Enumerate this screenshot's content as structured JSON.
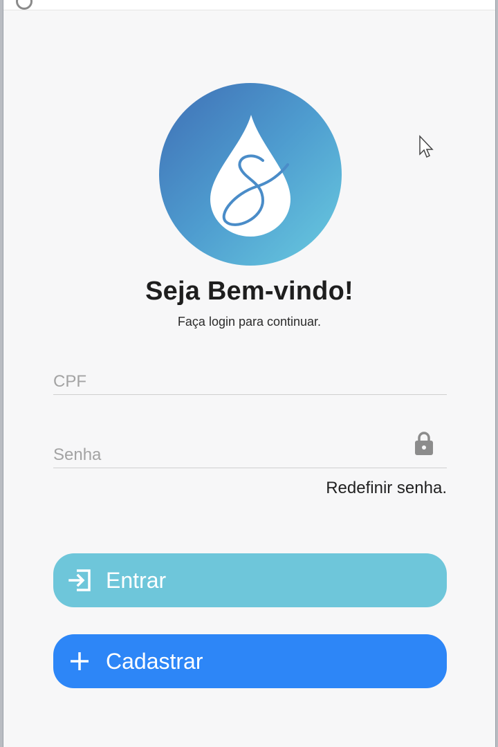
{
  "window": {
    "titlebar_icon": "app-icon"
  },
  "logo": {
    "icon": "water-drop-logo",
    "letter": "S",
    "colors": {
      "gradient_start": "#3f6fb5",
      "gradient_end": "#69cbe0"
    }
  },
  "welcome": {
    "title": "Seja Bem-vindo!",
    "subtitle": "Faça login para continuar."
  },
  "form": {
    "cpf": {
      "placeholder": "CPF",
      "value": ""
    },
    "senha": {
      "placeholder": "Senha",
      "value": "",
      "icon": "lock-icon"
    },
    "reset_link": "Redefinir senha."
  },
  "buttons": {
    "entrar": {
      "label": "Entrar",
      "icon": "login-icon",
      "color": "#6ec6da"
    },
    "cadastrar": {
      "label": "Cadastrar",
      "icon": "plus-icon",
      "color": "#2d86f7"
    }
  }
}
